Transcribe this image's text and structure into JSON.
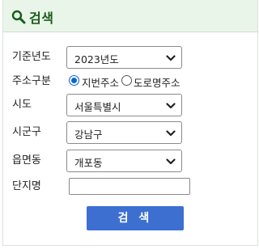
{
  "header": {
    "title": "검색",
    "icon": "search-icon"
  },
  "form": {
    "base_year": {
      "label": "기준년도",
      "value": "2023년도"
    },
    "address_type": {
      "label": "주소구분",
      "options": [
        {
          "label": "지번주소",
          "checked": true
        },
        {
          "label": "도로명주소",
          "checked": false
        }
      ]
    },
    "city": {
      "label": "시도",
      "value": "서울특별시"
    },
    "district": {
      "label": "시군구",
      "value": "강남구"
    },
    "town": {
      "label": "읍면동",
      "value": "개포동"
    },
    "complex_name": {
      "label": "단지명",
      "value": "",
      "placeholder": ""
    },
    "search_button": {
      "label": "검 색"
    }
  },
  "colors": {
    "header_bg": "#eaf5ea",
    "header_text": "#1a5c1a",
    "button_bg": "#3d6fd1",
    "radio_accent": "#0a64d6"
  }
}
